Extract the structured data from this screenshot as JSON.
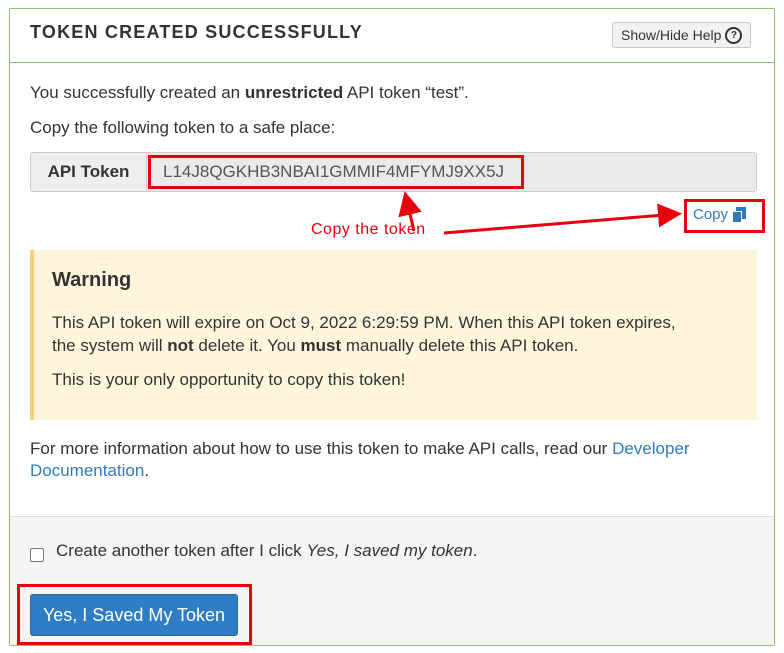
{
  "panel": {
    "title": "TOKEN CREATED SUCCESSFULLY",
    "help_button": "Show/Hide Help",
    "help_icon": "?"
  },
  "message": {
    "prefix": "You successfully created an ",
    "bold": "unrestricted",
    "suffix": " API token “test”."
  },
  "instruction": "Copy the following token to a safe place:",
  "token": {
    "label": "API Token",
    "value": "L14J8QGKHB3NBAI1GMMIF4MFYMJ9XX5J"
  },
  "copy_link": "Copy",
  "annotation": "Copy the token",
  "warning": {
    "title": "Warning",
    "line1": "This API token will expire on Oct 9, 2022 6:29:59 PM. When this API token expires,",
    "line2_a": "the system will ",
    "line2_b": "not",
    "line2_c": " delete it. You ",
    "line2_d": "must",
    "line2_e": " manually delete this API token.",
    "line3": "This is your only opportunity to copy this token!"
  },
  "info": {
    "line1": "For more information about how to use this token to make API calls, read our ",
    "link1": "Developer",
    "link2": "Documentation",
    "end": "."
  },
  "footer": {
    "checkbox_label_a": "Create another token after I click ",
    "checkbox_label_italic": "Yes, I saved my token",
    "checkbox_label_end": ".",
    "checkbox_checked": false,
    "submit_button": "Yes, I Saved My Token"
  },
  "colors": {
    "panel_border": "#8cc36b",
    "annotation_red": "#e8000b",
    "link_blue": "#2f7bc0",
    "primary_button": "#2f7dc4",
    "warning_bg": "#fdf6dc"
  }
}
